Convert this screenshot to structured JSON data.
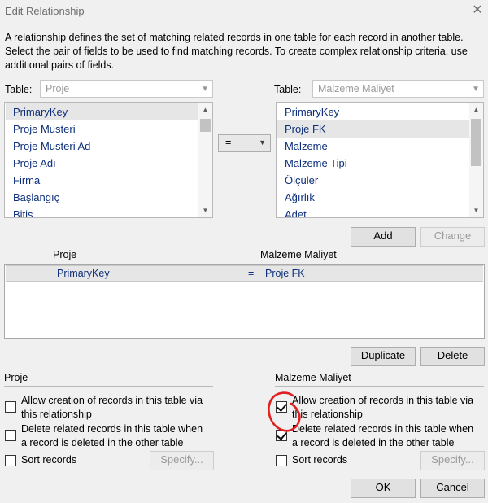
{
  "window": {
    "title": "Edit Relationship",
    "close_glyph": "✕",
    "description": "A relationship defines the set of matching related records in one table for each record in another table. Select the pair of fields to be used to find matching records. To create complex relationship criteria, use additional pairs of fields."
  },
  "left": {
    "table_label": "Table:",
    "table_value": "Proje",
    "fields": [
      "PrimaryKey",
      "Proje Musteri",
      "Proje Musteri Ad",
      "Proje Adı",
      "Firma",
      "Başlangıç",
      "Bitiş"
    ],
    "selected_index": 0
  },
  "right": {
    "table_label": "Table:",
    "table_value": "Malzeme Maliyet",
    "fields": [
      "PrimaryKey",
      "Proje FK",
      "Malzeme",
      "Malzeme Tipi",
      "Ölçüler",
      "Ağırlık",
      "Adet"
    ],
    "selected_index": 1
  },
  "operator": {
    "value": "="
  },
  "buttons": {
    "add": "Add",
    "change": "Change",
    "duplicate": "Duplicate",
    "delete": "Delete",
    "specify": "Specify...",
    "ok": "OK",
    "cancel": "Cancel"
  },
  "pairs": {
    "left_header": "Proje",
    "right_header": "Malzeme Maliyet",
    "rows": [
      {
        "left": "PrimaryKey",
        "op": "=",
        "right": "Proje FK"
      }
    ]
  },
  "options_left": {
    "title": "Proje",
    "allow_line1": "Allow creation of records in this table via",
    "allow_line2": "this relationship",
    "allow_checked": false,
    "delete_line1": "Delete related records in this table when",
    "delete_line2": "a record is deleted in the other table",
    "delete_checked": false,
    "sort_label": "Sort records",
    "sort_checked": false
  },
  "options_right": {
    "title": "Malzeme Maliyet",
    "allow_line1": "Allow creation of records in this table via",
    "allow_line2": "this relationship",
    "allow_checked": true,
    "delete_line1": "Delete related records in this table when",
    "delete_line2": "a record is deleted in the other table",
    "delete_checked": true,
    "sort_label": "Sort records",
    "sort_checked": false
  },
  "colors": {
    "field_text": "#0c2e7a",
    "annotation": "#e02020"
  }
}
